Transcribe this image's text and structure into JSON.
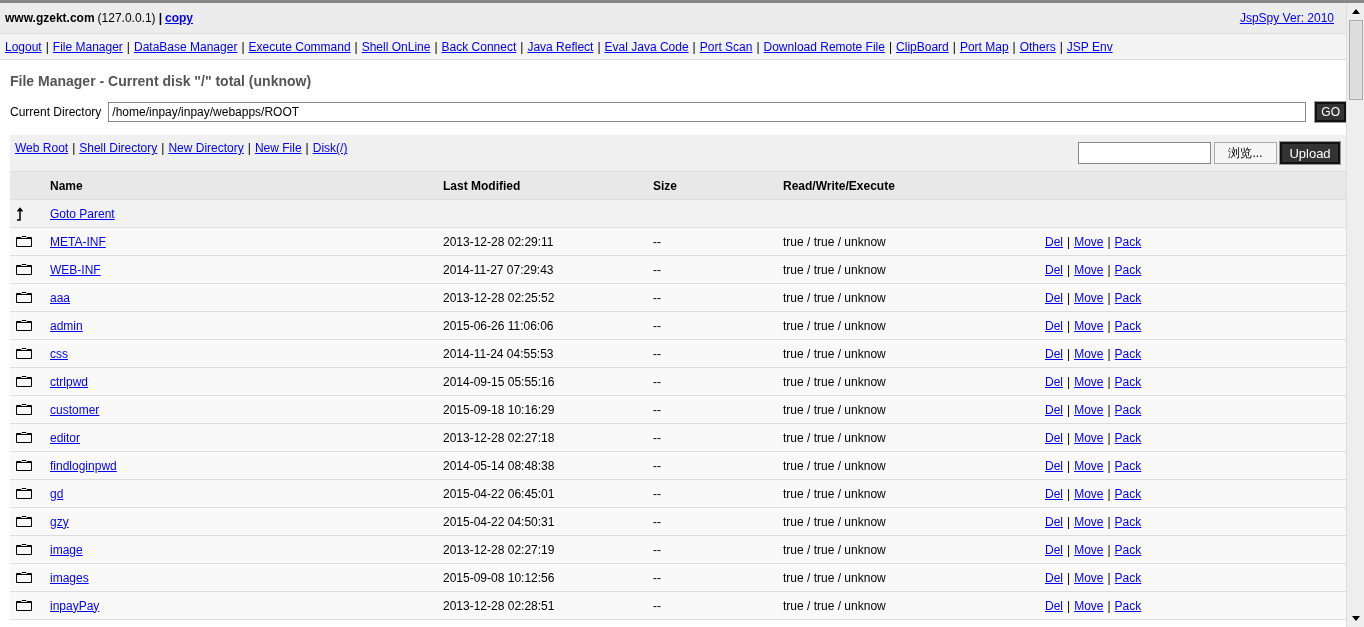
{
  "header": {
    "host": "www.gzekt.com",
    "ip": "(127.0.0.1)",
    "separator": "|",
    "copy_link": "copy",
    "version": "JspSpy Ver: 2010"
  },
  "nav": {
    "separator": "|",
    "links": [
      "Logout",
      "File Manager",
      "DataBase Manager",
      "Execute Command",
      "Shell OnLine",
      "Back Connect",
      "Java Reflect",
      "Eval Java Code",
      "Port Scan",
      "Download Remote File",
      "ClipBoard",
      "Port Map",
      "Others",
      "JSP Env"
    ]
  },
  "title": "File Manager - Current disk \"/\" total (unknow)",
  "directory": {
    "label": "Current Directory",
    "value": "/home/inpay/inpay/webapps/ROOT",
    "button": "GO"
  },
  "toolbar": {
    "separator": "|",
    "links": [
      "Web Root",
      "Shell Directory",
      "New Directory",
      "New File",
      "Disk(/)"
    ],
    "browse_button": "浏览...",
    "upload_button": "Upload"
  },
  "table": {
    "columns": [
      "Name",
      "Last Modified",
      "Size",
      "Read/Write/Execute"
    ],
    "parent": "Goto Parent",
    "action_separator": "|",
    "rows": [
      {
        "name": "META-INF",
        "modified": "2013-12-28 02:29:11",
        "size": "--",
        "permissions": "true / true / unknow",
        "actions": [
          "Del",
          "Move",
          "Pack"
        ]
      },
      {
        "name": "WEB-INF",
        "modified": "2014-11-27 07:29:43",
        "size": "--",
        "permissions": "true / true / unknow",
        "actions": [
          "Del",
          "Move",
          "Pack"
        ]
      },
      {
        "name": "aaa",
        "modified": "2013-12-28 02:25:52",
        "size": "--",
        "permissions": "true / true / unknow",
        "actions": [
          "Del",
          "Move",
          "Pack"
        ]
      },
      {
        "name": "admin",
        "modified": "2015-06-26 11:06:06",
        "size": "--",
        "permissions": "true / true / unknow",
        "actions": [
          "Del",
          "Move",
          "Pack"
        ]
      },
      {
        "name": "css",
        "modified": "2014-11-24 04:55:53",
        "size": "--",
        "permissions": "true / true / unknow",
        "actions": [
          "Del",
          "Move",
          "Pack"
        ]
      },
      {
        "name": "ctrlpwd",
        "modified": "2014-09-15 05:55:16",
        "size": "--",
        "permissions": "true / true / unknow",
        "actions": [
          "Del",
          "Move",
          "Pack"
        ]
      },
      {
        "name": "customer",
        "modified": "2015-09-18 10:16:29",
        "size": "--",
        "permissions": "true / true / unknow",
        "actions": [
          "Del",
          "Move",
          "Pack"
        ]
      },
      {
        "name": "editor",
        "modified": "2013-12-28 02:27:18",
        "size": "--",
        "permissions": "true / true / unknow",
        "actions": [
          "Del",
          "Move",
          "Pack"
        ]
      },
      {
        "name": "findloginpwd",
        "modified": "2014-05-14 08:48:38",
        "size": "--",
        "permissions": "true / true / unknow",
        "actions": [
          "Del",
          "Move",
          "Pack"
        ]
      },
      {
        "name": "gd",
        "modified": "2015-04-22 06:45:01",
        "size": "--",
        "permissions": "true / true / unknow",
        "actions": [
          "Del",
          "Move",
          "Pack"
        ]
      },
      {
        "name": "gzy",
        "modified": "2015-04-22 04:50:31",
        "size": "--",
        "permissions": "true / true / unknow",
        "actions": [
          "Del",
          "Move",
          "Pack"
        ]
      },
      {
        "name": "image",
        "modified": "2013-12-28 02:27:19",
        "size": "--",
        "permissions": "true / true / unknow",
        "actions": [
          "Del",
          "Move",
          "Pack"
        ]
      },
      {
        "name": "images",
        "modified": "2015-09-08 10:12:56",
        "size": "--",
        "permissions": "true / true / unknow",
        "actions": [
          "Del",
          "Move",
          "Pack"
        ]
      },
      {
        "name": "inpayPay",
        "modified": "2013-12-28 02:28:51",
        "size": "--",
        "permissions": "true / true / unknow",
        "actions": [
          "Del",
          "Move",
          "Pack"
        ]
      }
    ]
  }
}
